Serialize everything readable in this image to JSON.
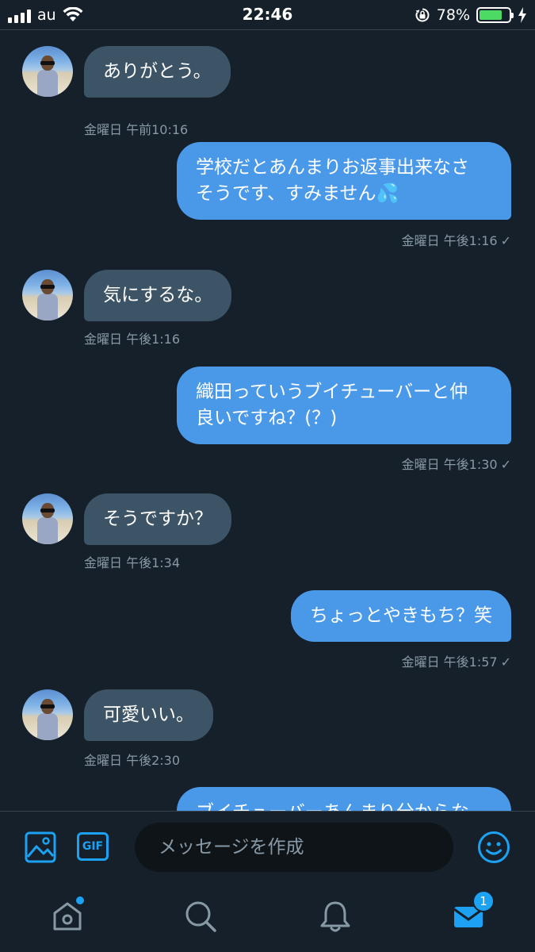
{
  "status_bar": {
    "carrier": "au",
    "time": "22:46",
    "battery_percent": "78%",
    "battery_level": 0.78,
    "battery_color": "#4cd964"
  },
  "messages": [
    {
      "direction": "in",
      "text": "ありがとう。",
      "timestamp": "金曜日 午前10:16"
    },
    {
      "direction": "out",
      "lines": [
        "学校だとあんまりお返事出来なさ",
        "そうです、すみません💦"
      ],
      "timestamp": "金曜日 午後1:16",
      "status": "✓"
    },
    {
      "direction": "in",
      "text": "気にするな。",
      "timestamp": "金曜日 午後1:16"
    },
    {
      "direction": "out",
      "lines": [
        "織田っていうブイチューバーと仲",
        "良いですね？(？)"
      ],
      "timestamp": "金曜日 午後1:30",
      "status": "✓"
    },
    {
      "direction": "in",
      "text": "そうですか？",
      "timestamp": "金曜日 午後1:34"
    },
    {
      "direction": "out",
      "lines": [
        "ちょっとやきもち？笑"
      ],
      "timestamp": "金曜日 午後1:57",
      "status": "✓"
    },
    {
      "direction": "in",
      "text": "可愛いい。",
      "timestamp": "金曜日 午後2:30"
    },
    {
      "direction": "out",
      "lines": [
        "ブイチューバーあんまり分からな"
      ],
      "partial": true
    }
  ],
  "composer": {
    "placeholder": "メッセージを作成",
    "gif_label": "GIF",
    "icons": [
      "image-icon",
      "gif-icon",
      "emoji-icon"
    ]
  },
  "tabbar": {
    "tabs": [
      "home-icon",
      "search-icon",
      "notifications-icon",
      "messages-icon"
    ],
    "messages_badge": "1"
  },
  "colors": {
    "background": "#15202b",
    "incoming_bubble": "#3d5466",
    "outgoing_bubble": "#4a99e9",
    "accent": "#1da1f2",
    "muted_text": "#8899a6"
  }
}
